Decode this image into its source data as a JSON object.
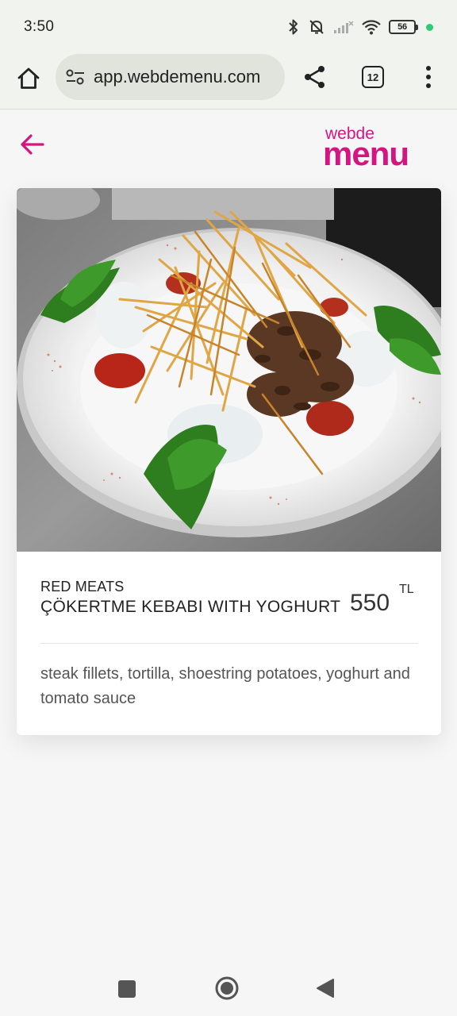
{
  "status": {
    "time": "3:50",
    "battery": "56"
  },
  "browser": {
    "url": "app.webdemenu.com",
    "tab_count": "12"
  },
  "header": {
    "logo_small": "webde",
    "logo_large": "menu",
    "brand_color": "#d4157f"
  },
  "dish": {
    "category": "RED MEATS",
    "name": "ÇÖKERTME KEBABI WITH YOGHURT",
    "price": "550",
    "currency": "TL",
    "description": "steak fillets, tortilla, shoestring potatoes, yoghurt and tomato sauce"
  }
}
